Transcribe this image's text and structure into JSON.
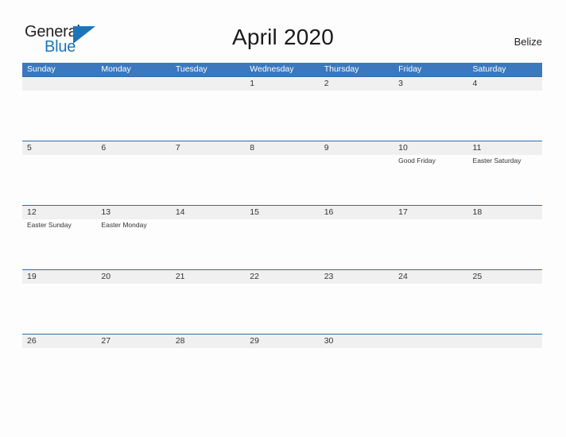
{
  "brand": {
    "name_part1": "General",
    "name_part2": "Blue",
    "triangle_color": "#1b75bb",
    "text_color": "#231f20",
    "accent_color": "#1b75bb"
  },
  "header": {
    "title": "April 2020",
    "country": "Belize"
  },
  "colors": {
    "header_band": "#3b78bd",
    "row_rule": "#2e6da4",
    "date_strip": "#f0f0f0",
    "page_background": "#fdfdfd"
  },
  "calendar": {
    "month": "April",
    "year": "2020",
    "weekdays": [
      "Sunday",
      "Monday",
      "Tuesday",
      "Wednesday",
      "Thursday",
      "Friday",
      "Saturday"
    ],
    "weeks": [
      {
        "tall": true,
        "days": [
          {
            "date": "",
            "event": ""
          },
          {
            "date": "",
            "event": ""
          },
          {
            "date": "",
            "event": ""
          },
          {
            "date": "1",
            "event": ""
          },
          {
            "date": "2",
            "event": ""
          },
          {
            "date": "3",
            "event": ""
          },
          {
            "date": "4",
            "event": ""
          }
        ]
      },
      {
        "tall": true,
        "days": [
          {
            "date": "5",
            "event": ""
          },
          {
            "date": "6",
            "event": ""
          },
          {
            "date": "7",
            "event": ""
          },
          {
            "date": "8",
            "event": ""
          },
          {
            "date": "9",
            "event": ""
          },
          {
            "date": "10",
            "event": "Good Friday"
          },
          {
            "date": "11",
            "event": "Easter Saturday"
          }
        ]
      },
      {
        "tall": true,
        "days": [
          {
            "date": "12",
            "event": "Easter Sunday"
          },
          {
            "date": "13",
            "event": "Easter Monday"
          },
          {
            "date": "14",
            "event": ""
          },
          {
            "date": "15",
            "event": ""
          },
          {
            "date": "16",
            "event": ""
          },
          {
            "date": "17",
            "event": ""
          },
          {
            "date": "18",
            "event": ""
          }
        ]
      },
      {
        "tall": true,
        "days": [
          {
            "date": "19",
            "event": ""
          },
          {
            "date": "20",
            "event": ""
          },
          {
            "date": "21",
            "event": ""
          },
          {
            "date": "22",
            "event": ""
          },
          {
            "date": "23",
            "event": ""
          },
          {
            "date": "24",
            "event": ""
          },
          {
            "date": "25",
            "event": ""
          }
        ]
      },
      {
        "tall": false,
        "days": [
          {
            "date": "26",
            "event": ""
          },
          {
            "date": "27",
            "event": ""
          },
          {
            "date": "28",
            "event": ""
          },
          {
            "date": "29",
            "event": ""
          },
          {
            "date": "30",
            "event": ""
          },
          {
            "date": "",
            "event": ""
          },
          {
            "date": "",
            "event": ""
          }
        ]
      }
    ]
  }
}
